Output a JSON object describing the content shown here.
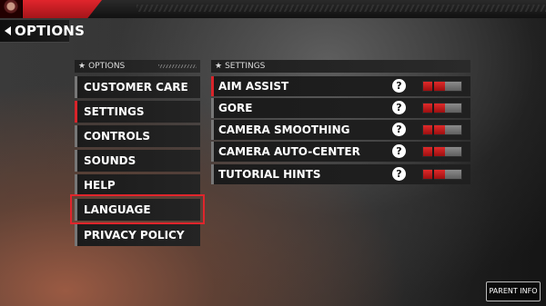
{
  "header": {
    "title": "OPTIONS"
  },
  "options_panel": {
    "header": "OPTIONS",
    "items": [
      {
        "label": "CUSTOMER CARE"
      },
      {
        "label": "SETTINGS"
      },
      {
        "label": "CONTROLS"
      },
      {
        "label": "SOUNDS"
      },
      {
        "label": "HELP"
      },
      {
        "label": "LANGUAGE"
      },
      {
        "label": "PRIVACY POLICY"
      }
    ],
    "active_item": "SETTINGS",
    "highlighted_item": "LANGUAGE"
  },
  "settings_panel": {
    "header": "SETTINGS",
    "rows": [
      {
        "label": "AIM ASSIST",
        "help": "?",
        "enabled": true
      },
      {
        "label": "GORE",
        "help": "?",
        "enabled": true
      },
      {
        "label": "CAMERA SMOOTHING",
        "help": "?",
        "enabled": true
      },
      {
        "label": "CAMERA AUTO-CENTER",
        "help": "?",
        "enabled": true
      },
      {
        "label": "TUTORIAL HINTS",
        "help": "?",
        "enabled": true
      }
    ]
  },
  "footer": {
    "parent_info_label": "PARENT INFO"
  },
  "colors": {
    "accent": "#e0252c",
    "toggle_on": "#d9242a",
    "toggle_off": "#7a7a7a"
  }
}
